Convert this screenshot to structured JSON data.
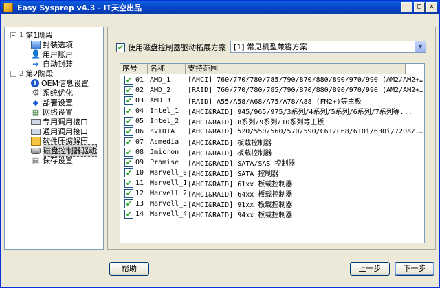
{
  "window": {
    "title": "Easy Sysprep v4.3 - IT天空出品"
  },
  "titlebar_buttons": {
    "minimize": "_",
    "maximize": "□",
    "close": "✕"
  },
  "tree": {
    "stage1": {
      "num": "1",
      "label": "第1阶段"
    },
    "stage1_items": [
      "封装选项",
      "用户账户",
      "自动封装"
    ],
    "stage2": {
      "num": "2",
      "label": "第2阶段"
    },
    "stage2_items": [
      "OEM信息设置",
      "系统优化",
      "部署设置",
      "网络设置",
      "专用调用接口",
      "通用调用接口",
      "软件压缩解压",
      "磁盘控制器驱动",
      "保存设置"
    ],
    "selected": "磁盘控制器驱动"
  },
  "panel": {
    "checkbox_label": "使用磁盘控制器驱动拓展方案",
    "combo_value": "[1] 常见机型兼容方案",
    "columns": [
      "序号",
      "名称",
      "支持范围"
    ],
    "rows": [
      {
        "no": "01",
        "name": "AMD_1",
        "range": "[AHCI] 760/770/780/785/790/870/880/890/970/990 (AM2/AM2+..."
      },
      {
        "no": "02",
        "name": "AMD_2",
        "range": "[RAID] 760/770/780/785/790/870/880/890/970/990 (AM2/AM2+..."
      },
      {
        "no": "03",
        "name": "AMD_3",
        "range": "[RAID] A55/A58/A68/A75/A78/A88 (FM2+)等主板"
      },
      {
        "no": "04",
        "name": "Intel_1",
        "range": "[AHCI&RAID] 945/965/975/3系列/4系列/5系列/6系列/7系列等..."
      },
      {
        "no": "05",
        "name": "Intel_2",
        "range": "[AHCI&RAID] 8系列/9系列/10系列等主板"
      },
      {
        "no": "06",
        "name": "nVIDIA",
        "range": "[AHCI&RAID] 520/550/560/570/590/C61/C68/610i/630i/720a/..."
      },
      {
        "no": "07",
        "name": "Asmedia",
        "range": "[AHCI&RAID] 板载控制器"
      },
      {
        "no": "08",
        "name": "Jmicron",
        "range": "[AHCI&RAID] 板载控制器"
      },
      {
        "no": "09",
        "name": "Promise",
        "range": "[AHCI&RAID] SATA/SAS 控制器"
      },
      {
        "no": "10",
        "name": "Marvell_0",
        "range": "[AHCI&RAID] SATA 控制器"
      },
      {
        "no": "11",
        "name": "Marvell_1",
        "range": "[AHCI&RAID] 61xx 板载控制器"
      },
      {
        "no": "12",
        "name": "Marvell_2",
        "range": "[AHCI&RAID] 64xx 板载控制器"
      },
      {
        "no": "13",
        "name": "Marvell_3",
        "range": "[AHCI&RAID] 91xx 板载控制器"
      },
      {
        "no": "14",
        "name": "Marvell_4",
        "range": "[AHCI&RAID] 94xx 板载控制器"
      }
    ]
  },
  "buttons": {
    "help": "帮助",
    "prev": "上一步",
    "next": "下一步"
  },
  "icons": {
    "stage1": [
      "screen-icon",
      "user-icon",
      "arrow-icon"
    ],
    "stage2": [
      "info-icon",
      "gear-icon",
      "deploy-icon",
      "network-icon",
      "interface-icon",
      "interface-icon",
      "zip-icon",
      "disk-icon",
      "save-icon"
    ]
  }
}
